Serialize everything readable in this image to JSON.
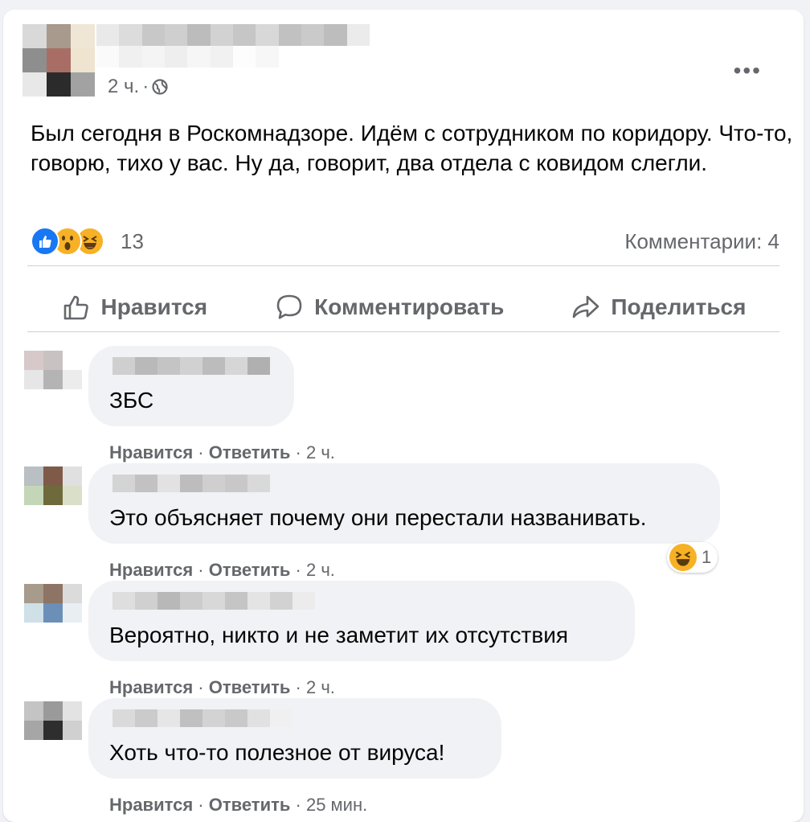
{
  "post": {
    "time": "2 ч.",
    "separator": "·",
    "more": "•••",
    "text": "Был сегодня в Роскомнадзоре. Идём с сотрудником по коридору. Что-то, говорю, тихо у вас. Ну да, говорит, два отдела с ковидом слегли.",
    "reaction_count": "13",
    "comments_label": "Комментарии: 4"
  },
  "actions": {
    "like": "Нравится",
    "comment": "Комментировать",
    "share": "Поделиться"
  },
  "comments": [
    {
      "text": "ЗБС",
      "like": "Нравится",
      "reply": "Ответить",
      "time": "2 ч."
    },
    {
      "text": "Это объясняет почему они перестали названивать.",
      "like": "Нравится",
      "reply": "Ответить",
      "time": "2 ч.",
      "reaction_count": "1"
    },
    {
      "text": "Вероятно, никто и не заметит их отсутствия",
      "like": "Нравится",
      "reply": "Ответить",
      "time": "2 ч."
    },
    {
      "text": "Хоть что-то полезное от вируса!",
      "like": "Нравится",
      "reply": "Ответить",
      "time": "25 мин."
    }
  ],
  "colors": {
    "accent": "#1877f2",
    "reaction_yellow": "#f7b125",
    "muted_text": "#65676b"
  }
}
